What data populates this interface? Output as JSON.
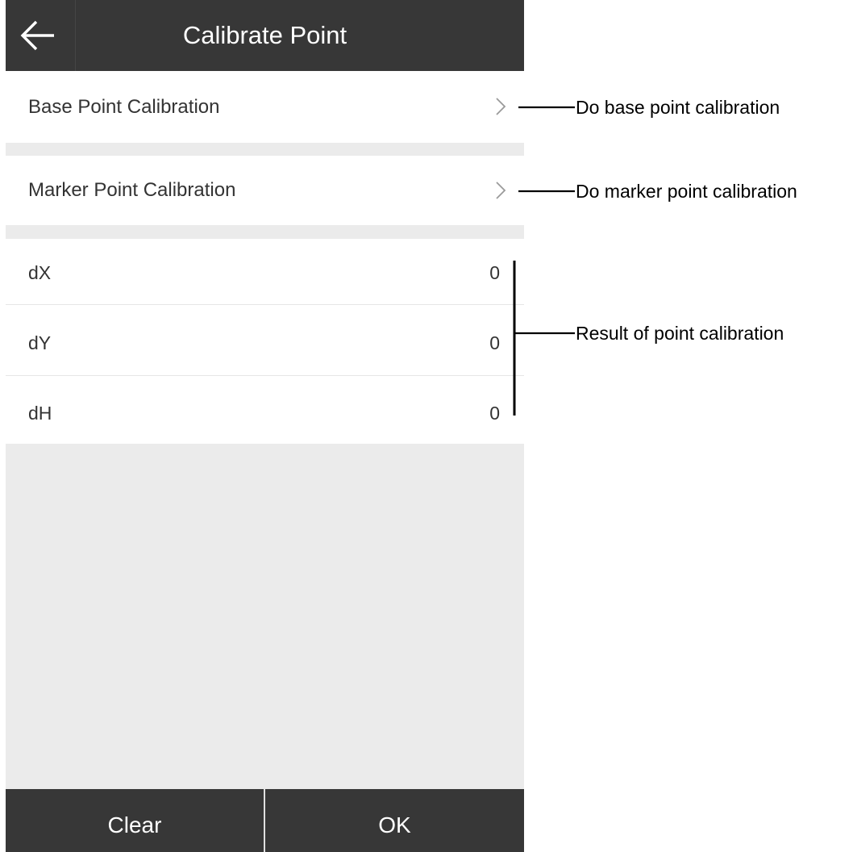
{
  "header": {
    "title": "Calibrate Point",
    "back_icon": "arrow-left-icon"
  },
  "menu": {
    "items": [
      {
        "label": "Base Point Calibration",
        "icon": "chevron-right-icon"
      },
      {
        "label": "Marker Point Calibration",
        "icon": "chevron-right-icon"
      }
    ]
  },
  "results": {
    "rows": [
      {
        "label": "dX",
        "value": "0"
      },
      {
        "label": "dY",
        "value": "0"
      },
      {
        "label": "dH",
        "value": "0"
      }
    ]
  },
  "footer": {
    "clear_label": "Clear",
    "ok_label": "OK"
  },
  "annotations": {
    "base": "Do base point calibration",
    "marker": "Do marker point calibration",
    "result": "Result of point calibration"
  },
  "colors": {
    "bar_background": "#373737",
    "screen_background": "#ebebeb",
    "row_background": "#ffffff",
    "text": "#333333"
  }
}
